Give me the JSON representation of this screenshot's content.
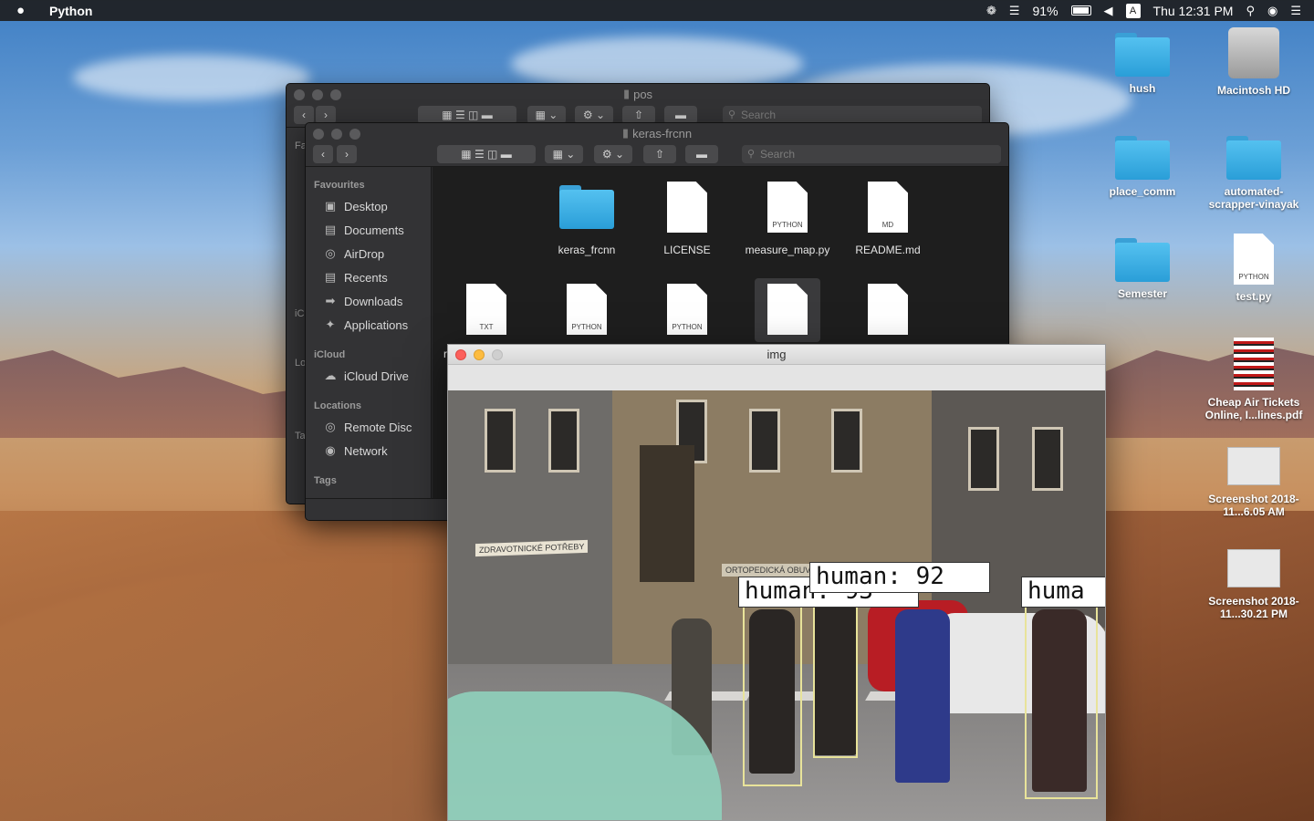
{
  "menubar": {
    "app_name": "Python",
    "battery": "91%",
    "input_source": "A",
    "clock": "Thu 12:31 PM"
  },
  "desktop_icons": [
    {
      "label": "hush",
      "kind": "folder"
    },
    {
      "label": "Macintosh HD",
      "kind": "drive"
    },
    {
      "label": "place_comm",
      "kind": "folder"
    },
    {
      "label": "automated-scrapper-vinayak",
      "kind": "folder"
    },
    {
      "label": "Semester",
      "kind": "folder"
    },
    {
      "label": "test.py",
      "kind": "python",
      "tag": "PYTHON"
    },
    {
      "label": "Cheap Air Tickets Online, I...lines.pdf",
      "kind": "pdf"
    },
    {
      "label": "Screenshot 2018-11...6.05 AM",
      "kind": "screenshot"
    },
    {
      "label": "Screenshot 2018-11...30.21 PM",
      "kind": "screenshot"
    }
  ],
  "finder_back": {
    "title": "pos",
    "search_placeholder": "Search",
    "sidebar_partial": [
      "Fa",
      "iC",
      "Lo",
      "Ta"
    ]
  },
  "finder_front": {
    "title": "keras-frcnn",
    "search_placeholder": "Search",
    "sidebar": {
      "favourites_header": "Favourites",
      "favourites": [
        "Desktop",
        "Documents",
        "AirDrop",
        "Recents",
        "Downloads",
        "Applications"
      ],
      "icloud_header": "iCloud",
      "icloud": [
        "iCloud Drive"
      ],
      "locations_header": "Locations",
      "locations": [
        "Remote Disc",
        "Network"
      ],
      "tags_header": "Tags"
    },
    "files": [
      {
        "name": "keras_frcnn",
        "kind": "folder",
        "tag": ""
      },
      {
        "name": "LICENSE",
        "kind": "doc",
        "tag": ""
      },
      {
        "name": "measure_map.py",
        "kind": "doc",
        "tag": "PYTHON"
      },
      {
        "name": "README.md",
        "kind": "doc",
        "tag": "MD"
      },
      {
        "name": "",
        "kind": "doc",
        "tag": "TXT"
      },
      {
        "name": "",
        "kind": "doc",
        "tag": "PYTHON"
      },
      {
        "name": "",
        "kind": "doc",
        "tag": "PYTHON"
      },
      {
        "name": "",
        "kind": "doc",
        "tag": ""
      },
      {
        "name": "",
        "kind": "doc",
        "tag": ""
      }
    ],
    "partial_label": "r"
  },
  "img_window": {
    "title": "img",
    "detections": [
      "human: 93",
      "human: 92",
      "huma"
    ],
    "signs": [
      "ZDRAVOTNICKÉ POTŘEBY",
      "ORTOPEDICKÁ OBUV NA ZAKÁZKU"
    ]
  }
}
